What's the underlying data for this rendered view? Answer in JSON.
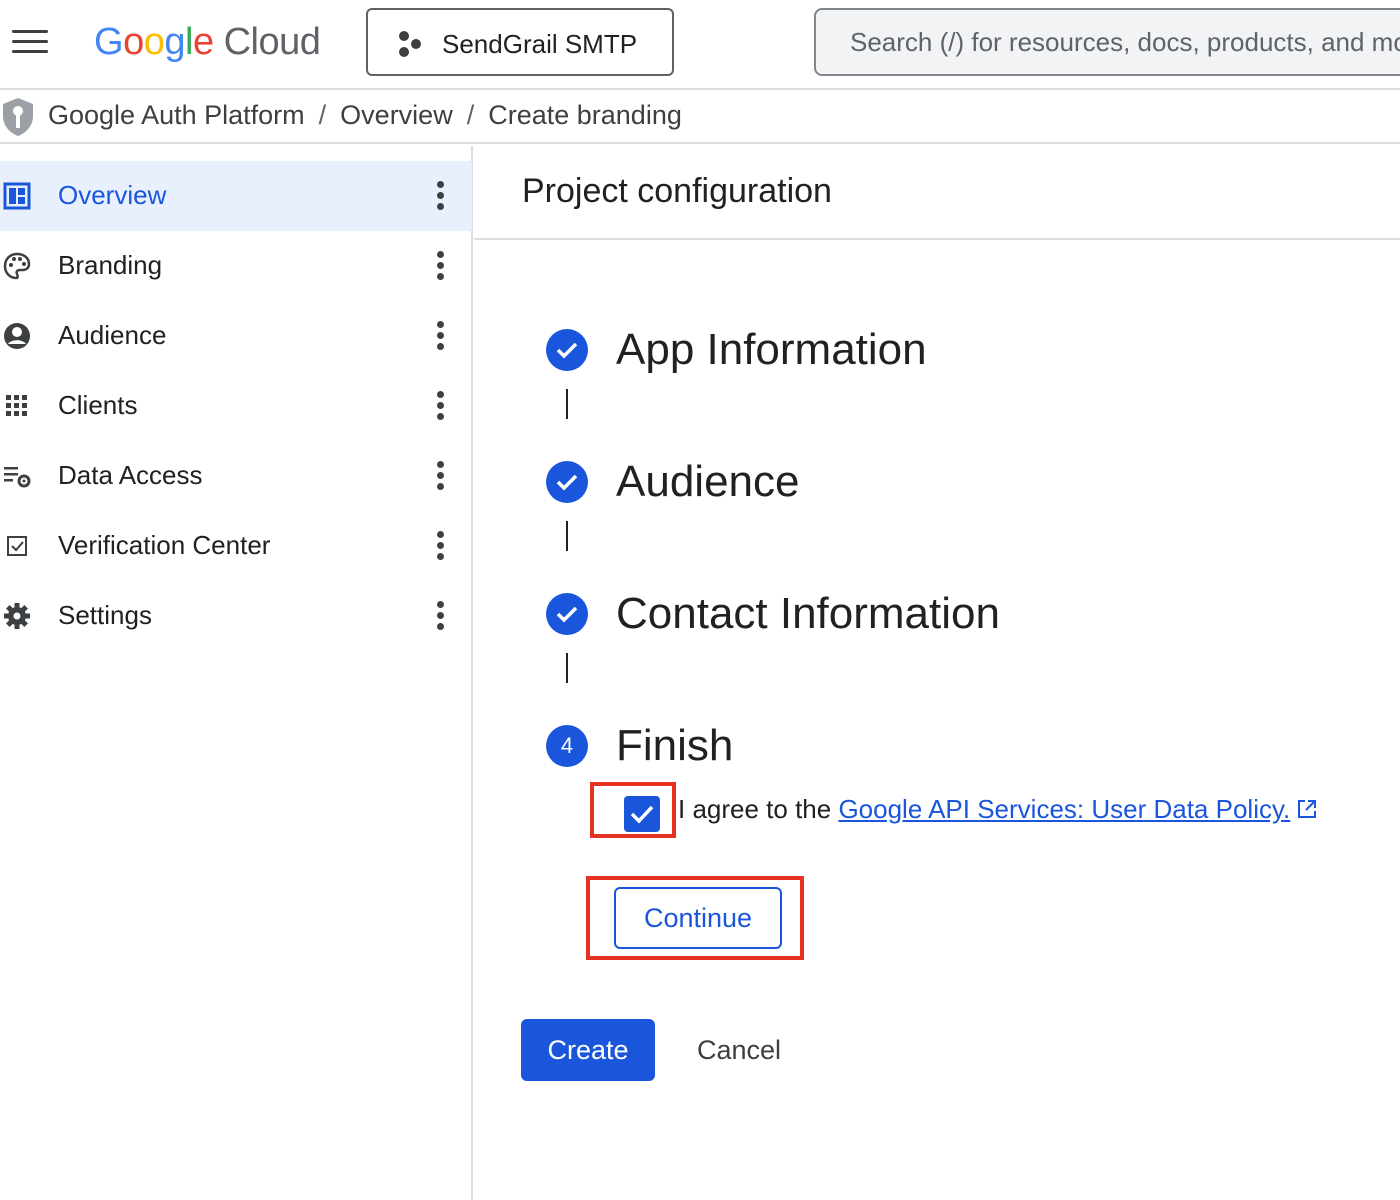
{
  "topbar": {
    "logo_google": "Google",
    "logo_cloud": "Cloud",
    "project_name": "SendGrail SMTP",
    "search_placeholder": "Search (/) for resources, docs, products, and more"
  },
  "breadcrumb": {
    "items": [
      "Google Auth Platform",
      "Overview",
      "Create branding"
    ],
    "separator": "/"
  },
  "sidebar": {
    "items": [
      {
        "label": "Overview",
        "icon": "dashboard-icon",
        "active": true
      },
      {
        "label": "Branding",
        "icon": "palette-icon",
        "active": false
      },
      {
        "label": "Audience",
        "icon": "account-circle-icon",
        "active": false
      },
      {
        "label": "Clients",
        "icon": "apps-grid-icon",
        "active": false
      },
      {
        "label": "Data Access",
        "icon": "data-settings-icon",
        "active": false
      },
      {
        "label": "Verification Center",
        "icon": "verification-icon",
        "active": false
      },
      {
        "label": "Settings",
        "icon": "gear-icon",
        "active": false
      }
    ]
  },
  "main": {
    "title": "Project configuration",
    "steps": [
      {
        "label": "App Information",
        "status": "complete"
      },
      {
        "label": "Audience",
        "status": "complete"
      },
      {
        "label": "Contact Information",
        "status": "complete"
      },
      {
        "label": "Finish",
        "status": "current",
        "number": "4"
      }
    ],
    "consent": {
      "checked": true,
      "prefix": "I agree to the ",
      "link_text": "Google API Services: User Data Policy."
    },
    "continue_label": "Continue",
    "create_label": "Create",
    "cancel_label": "Cancel"
  },
  "colors": {
    "accent": "#1a56db",
    "highlight": "#e53225",
    "active_bg": "#e8f0fe",
    "border": "#dadce0"
  }
}
